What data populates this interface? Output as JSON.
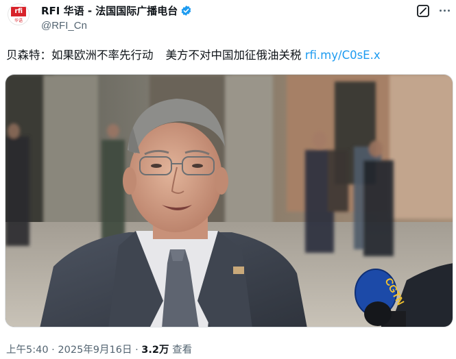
{
  "account": {
    "avatar_logo": "rfi",
    "avatar_sub": "华语",
    "display_name": "RFI 华语 - 法国国际广播电台",
    "handle": "@RFI_Cn"
  },
  "tweet": {
    "text_part1": "贝森特：如果欧洲不率先行动",
    "text_part2": "美方不对中国加征俄油关税",
    "link": "rfi.my/C0sE.x"
  },
  "media": {
    "mic_label": "CGTN"
  },
  "meta": {
    "time": "上午5:40",
    "sep1": " · ",
    "date": "2025年9月16日",
    "sep2": " · ",
    "views_count": "3.2万",
    "views_label": " 查看"
  },
  "icons": {
    "verified": "verified-badge-icon",
    "grok": "grok-icon",
    "more": "more-options-icon"
  },
  "colors": {
    "link": "#1d9bf0",
    "secondary_text": "#536471",
    "brand_red": "#d8222a"
  }
}
